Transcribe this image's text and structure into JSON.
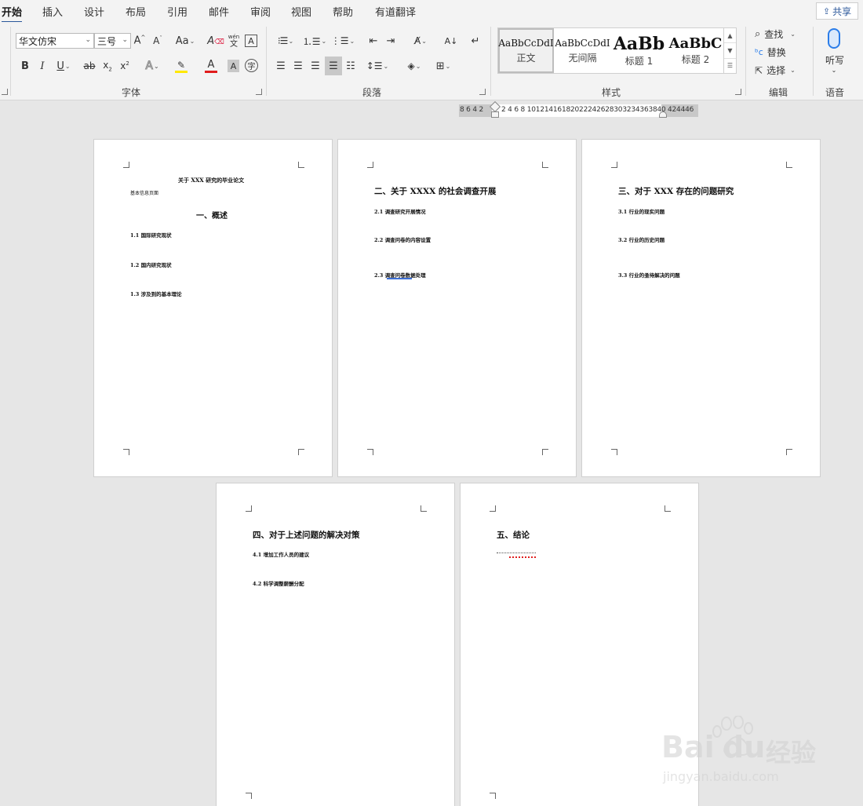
{
  "tabs": [
    "开始",
    "插入",
    "设计",
    "布局",
    "引用",
    "邮件",
    "审阅",
    "视图",
    "帮助",
    "有道翻译"
  ],
  "share_label": "共享",
  "font": {
    "family_value": "华文仿宋",
    "size_value": "三号",
    "group_label": "字体",
    "case_label": "Aa",
    "phonetic_top": "wén",
    "phonetic_bottom": "文",
    "highlight_color": "#ffe800",
    "font_color": "#e01c1c"
  },
  "paragraph": {
    "group_label": "段落"
  },
  "styles": {
    "group_label": "样式",
    "items": [
      {
        "preview": "AaBbCcDdI",
        "name": "正文"
      },
      {
        "preview": "AaBbCcDdI",
        "name": "无间隔"
      },
      {
        "preview": "AaBb",
        "name": "标题 1"
      },
      {
        "preview": "AaBbC",
        "name": "标题 2"
      }
    ]
  },
  "editing": {
    "group_label": "编辑",
    "find": "查找",
    "replace": "替换",
    "select": "选择"
  },
  "voice": {
    "group_label": "语音",
    "dictate": "听写"
  },
  "ruler": {
    "left_numbers": "8 6 4 2",
    "right_numbers": "2  4  6  8 10121416182022242628303234363840",
    "end_numbers": "424446"
  },
  "pages": {
    "p1": {
      "title": "关于 XXX 研究的毕业论文",
      "subtitle": "基本信息页面",
      "heading": "一、概述",
      "items": [
        "1.1 国际研究现状",
        "1.2 国内研究现状",
        "1.3 涉及到的基本理论"
      ]
    },
    "p2": {
      "heading": "二、关于 XXXX 的社会调查开展",
      "items": [
        "2.1 调查研究开展情况",
        "2.2 调查问卷的内容设置",
        "2.3 调查问卷数据处理"
      ]
    },
    "p3": {
      "heading": "三、对于 XXX 存在的问题研究",
      "items": [
        "3.1 行业的现实问题",
        "3.2 行业的历史问题",
        "3.3 行业的亟待解决的问题"
      ]
    },
    "p4": {
      "heading": "四、对于上述问题的解决对策",
      "items": [
        "4.1 增加工作人员的建议",
        "4.2 科学调整薪酬分配"
      ]
    },
    "p5": {
      "heading": "五、结论"
    }
  },
  "watermark": {
    "brand": "Bai",
    "brand2": "du",
    "cn": "经验",
    "url": "jingyan.baidu.com"
  }
}
